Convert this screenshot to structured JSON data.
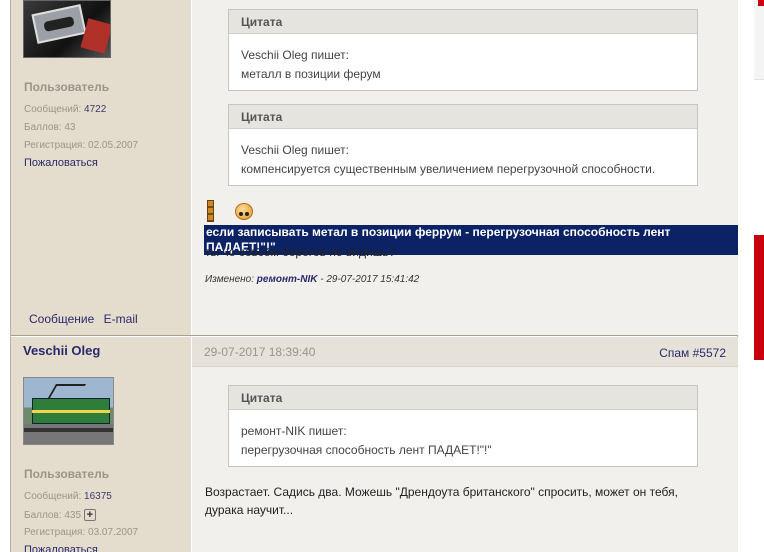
{
  "post1": {
    "author": {
      "role": "Пользователь",
      "messages_label": "Сообщений:",
      "messages_value": "4722",
      "points_label": "Баллов:",
      "points_value": "43",
      "reg_label": "Регистрация:",
      "reg_value": "02.05.2007",
      "report_label": "Пожаловаться"
    },
    "contact": {
      "message_label": "Сообщение",
      "email_label": "E-mail"
    },
    "quotes": [
      {
        "header": "Цитата",
        "author_line": "Veschii Oleg пишет:",
        "text": "металл в позиции ферум"
      },
      {
        "header": "Цитата",
        "author_line": "Veschii Oleg пишет:",
        "text": "компенсируется существенным увеличением перегрузочной способности."
      }
    ],
    "highlight_text": "если записывать метал в позиции феррум - перегрузочная способность лент ПАДАЕТ!\"!\"",
    "reply_text": "ты чо совсем берегов не видишь?",
    "edited": {
      "label": "Изменено:",
      "who": "ремонт-NIK",
      "when": "- 29-07-2017 15:41:42"
    }
  },
  "post2": {
    "author": {
      "username": "Veschii Oleg",
      "role": "Пользователь",
      "messages_label": "Сообщений:",
      "messages_value": "16375",
      "points_label": "Баллов:",
      "points_value": "435",
      "plus": "+",
      "reg_label": "Регистрация:",
      "reg_value": "03.07.2007",
      "report_label": "Пожаловаться"
    },
    "date": "29-07-2017 18:39:40",
    "spam": "Спам #5572",
    "quote": {
      "header": "Цитата",
      "author_line": "ремонт-NIK пишет:",
      "text": "перегрузочная способность лент ПАДАЕТ!\"!\""
    },
    "reply_line1": "Возрастает. Садись два. Можешь \"Дрендоута британского\" спросить, может он тебя,",
    "reply_line2": "дурака научит..."
  }
}
